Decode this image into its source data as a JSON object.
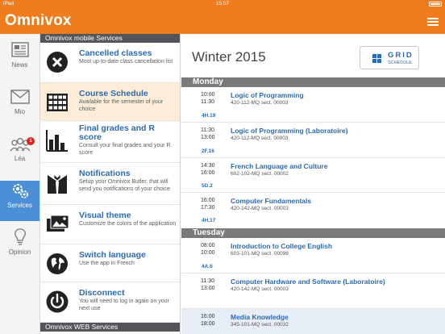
{
  "status": {
    "carrier": "iPad",
    "time": "15:57"
  },
  "app": {
    "title": "Omnivox"
  },
  "nav": [
    {
      "label": "News",
      "icon": "news-icon"
    },
    {
      "label": "Mio",
      "icon": "mail-icon"
    },
    {
      "label": "Léa",
      "icon": "people-icon",
      "badge": "1"
    },
    {
      "label": "Services",
      "icon": "services-icon",
      "active": true
    },
    {
      "label": "Opinion",
      "icon": "lightbulb-icon"
    }
  ],
  "services": {
    "header": "Omnivox mobile Services",
    "footer_header": "Omnivox WEB Services",
    "items": [
      {
        "title": "Cancelled classes",
        "desc": "Most up-to-date class cancellation list",
        "icon": "cancel-icon"
      },
      {
        "title": "Course Schedule",
        "desc": "Available for the semester of your choice",
        "icon": "schedule-grid-icon"
      },
      {
        "title": "Final grades and R score",
        "desc": "Consult your final grades and your R score",
        "icon": "bar-chart-icon"
      },
      {
        "title": "Notifications",
        "desc": "Setup your Omnivox Butler, that will send you notifications of your choice",
        "icon": "butler-icon"
      },
      {
        "title": "Visual theme",
        "desc": "Customize the colors of the application",
        "icon": "picture-icon"
      },
      {
        "title": "Switch language",
        "desc": "Use the app in French",
        "icon": "globe-icon"
      },
      {
        "title": "Disconnect",
        "desc": "You will need to log in again on your next use",
        "icon": "power-icon"
      }
    ]
  },
  "schedule": {
    "title": "Winter 2015",
    "grid_button": {
      "line1": "GRID",
      "line2": "SCHEDULE"
    },
    "days": [
      {
        "name": "Monday",
        "courses": [
          {
            "start": "10:00",
            "end": "11:30",
            "room": "4H.19",
            "name": "Logic of Programming",
            "section": "420-112-MQ sect. 00003"
          },
          {
            "start": "11:30",
            "end": "13:00",
            "room": "2F.16",
            "name": "Logic of Programming (Laboratoire)",
            "section": "420-112-MQ sect. 00003"
          },
          {
            "start": "14:30",
            "end": "16:00",
            "room": "5D.2",
            "name": "French Language and Culture",
            "section": "602-102-MQ sect. 00002"
          },
          {
            "start": "16:00",
            "end": "17:30",
            "room": "4H.17",
            "name": "Computer Fundamentals",
            "section": "420-142-MQ sect. 00003"
          }
        ]
      },
      {
        "name": "Tuesday",
        "courses": [
          {
            "start": "08:00",
            "end": "10:00",
            "room": "4A.6",
            "name": "Introduction to College English",
            "section": "603-101-MQ sect. 00096"
          },
          {
            "start": "11:30",
            "end": "13:00",
            "room": "",
            "name": "Computer Hardware and Software (Laboratoire)",
            "section": "420-142-MQ sect. 00003"
          },
          {
            "start": "16:00",
            "end": "18:00",
            "room": "",
            "name": "Media Knowledge",
            "section": "345-101-MQ sect. 00032"
          }
        ]
      }
    ]
  },
  "colors": {
    "brand": "#f07d1d",
    "link": "#2a6ab8",
    "active_nav": "#4b8fd6",
    "highlight": "#fdecd8"
  }
}
